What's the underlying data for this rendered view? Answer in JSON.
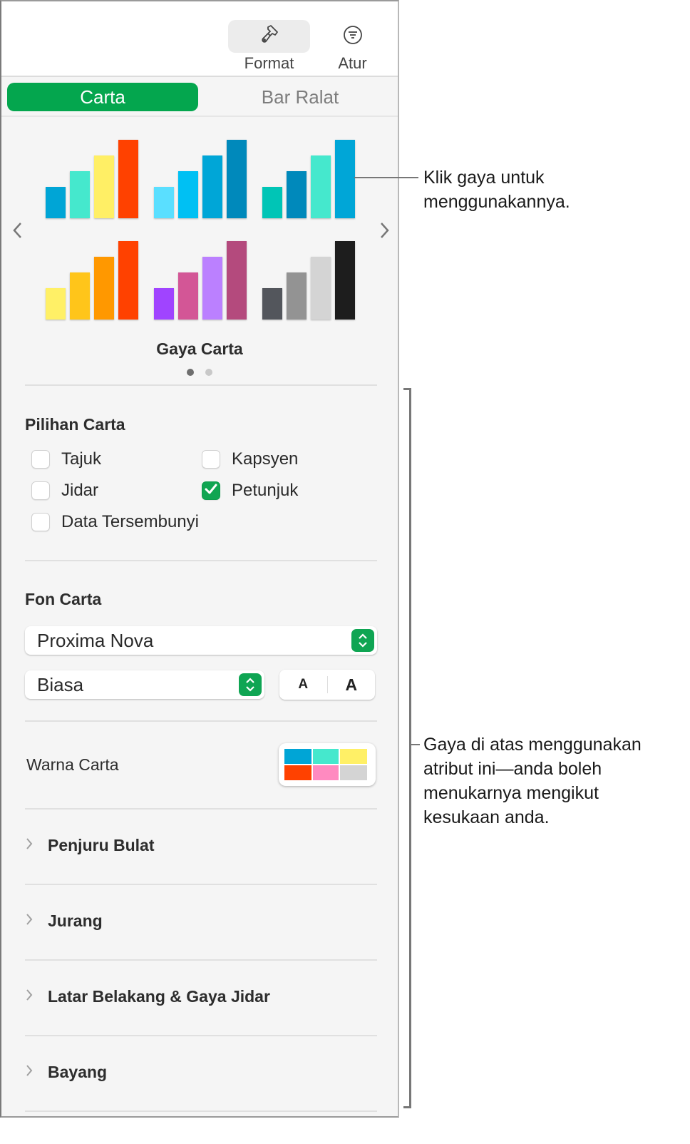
{
  "toolbar": {
    "buttons": [
      {
        "label": "Format",
        "icon": "paintbrush-icon",
        "active": true
      },
      {
        "label": "Atur",
        "icon": "arrange-icon",
        "active": false
      }
    ]
  },
  "tabs": [
    {
      "label": "Carta",
      "active": true
    },
    {
      "label": "Bar Ralat",
      "active": false
    }
  ],
  "chart_styles": {
    "title": "Gaya Carta",
    "page_count": 2,
    "current_page": 1,
    "thumbnails": [
      {
        "colors": [
          "#00a5d6",
          "#45e8cd",
          "#ffef65",
          "#ff4100"
        ]
      },
      {
        "colors": [
          "#5adfff",
          "#00c0f3",
          "#00a6d7",
          "#0089bb"
        ]
      },
      {
        "colors": [
          "#00c5b6",
          "#0089bb",
          "#45e8cd",
          "#00a6d7"
        ]
      },
      {
        "colors": [
          "#fff066",
          "#ffc51a",
          "#ff9800",
          "#ff4100"
        ]
      },
      {
        "colors": [
          "#a044ff",
          "#d35696",
          "#bb80ff",
          "#b44a7d"
        ]
      },
      {
        "colors": [
          "#53565c",
          "#939393",
          "#d4d4d4",
          "#1d1d1d"
        ]
      }
    ],
    "bar_levels": [
      0.4,
      0.6,
      0.8,
      1.0
    ]
  },
  "chart_options": {
    "title": "Pilihan Carta",
    "checkboxes": [
      {
        "label": "Tajuk",
        "checked": false
      },
      {
        "label": "Kapsyen",
        "checked": false
      },
      {
        "label": "Jidar",
        "checked": false
      },
      {
        "label": "Petunjuk",
        "checked": true
      },
      {
        "label": "Data Tersembunyi",
        "checked": false
      }
    ]
  },
  "chart_font": {
    "title": "Fon Carta",
    "font_family": "Proxima Nova",
    "font_style": "Biasa",
    "decrease_label": "A",
    "increase_label": "A"
  },
  "chart_colors": {
    "label": "Warna Carta",
    "swatches": [
      "#00a5d6",
      "#45e8cd",
      "#fff066",
      "#ff4100",
      "#ff8ac0",
      "#d4d4d4"
    ]
  },
  "disclosures": [
    {
      "label": "Penjuru Bulat"
    },
    {
      "label": "Jurang"
    },
    {
      "label": "Latar Belakang & Gaya Jidar"
    },
    {
      "label": "Bayang"
    }
  ],
  "callouts": {
    "styles": "Klik gaya untuk menggunakannya.",
    "attributes": "Gaya di atas menggunakan atribut ini—anda boleh menukarnya mengikut kesukaan anda."
  },
  "colors": {
    "accent": "#04a64e",
    "dot_active": "#6e6e6e",
    "dot_inactive": "#c8c8c8"
  }
}
